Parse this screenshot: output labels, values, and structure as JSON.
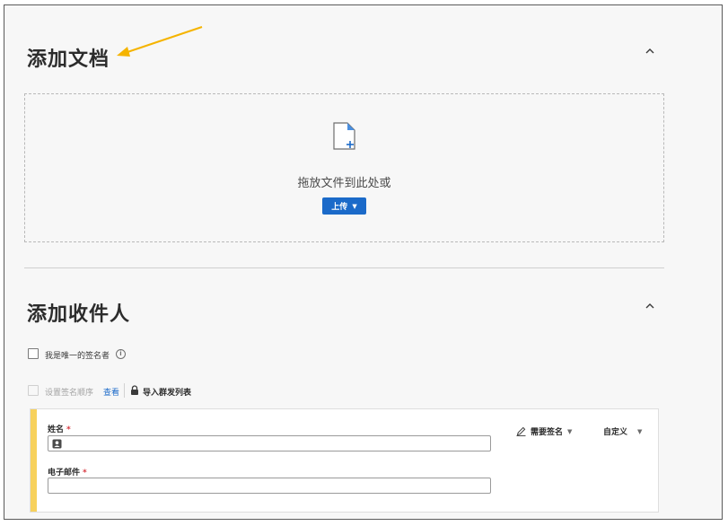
{
  "add_documents": {
    "title": "添加文档",
    "drop_text": "拖放文件到此处或",
    "upload_label": "上传",
    "icons": {
      "file": "file-add-icon",
      "collapse": "chevron-up-icon",
      "upload_caret": "caret-down-icon"
    }
  },
  "add_recipients": {
    "title": "添加收件人",
    "only_signer_label": "我是唯一的签名者",
    "set_order_label": "设置签名顺序",
    "view_link": "查看",
    "import_label": "导入群发列表",
    "icons": {
      "info": "info-icon",
      "lock": "lock-icon",
      "collapse": "chevron-up-icon"
    }
  },
  "recipient": {
    "name_label": "姓名",
    "name_value": "",
    "email_label": "电子邮件",
    "email_value": "",
    "required_mark": "*",
    "role_label": "需要签名",
    "custom_label": "自定义",
    "accent_color": "#f7d15c"
  },
  "annotation": {
    "arrow_color": "#f5b400"
  },
  "colors": {
    "primary": "#1b6ac9",
    "required": "#d7373f"
  }
}
